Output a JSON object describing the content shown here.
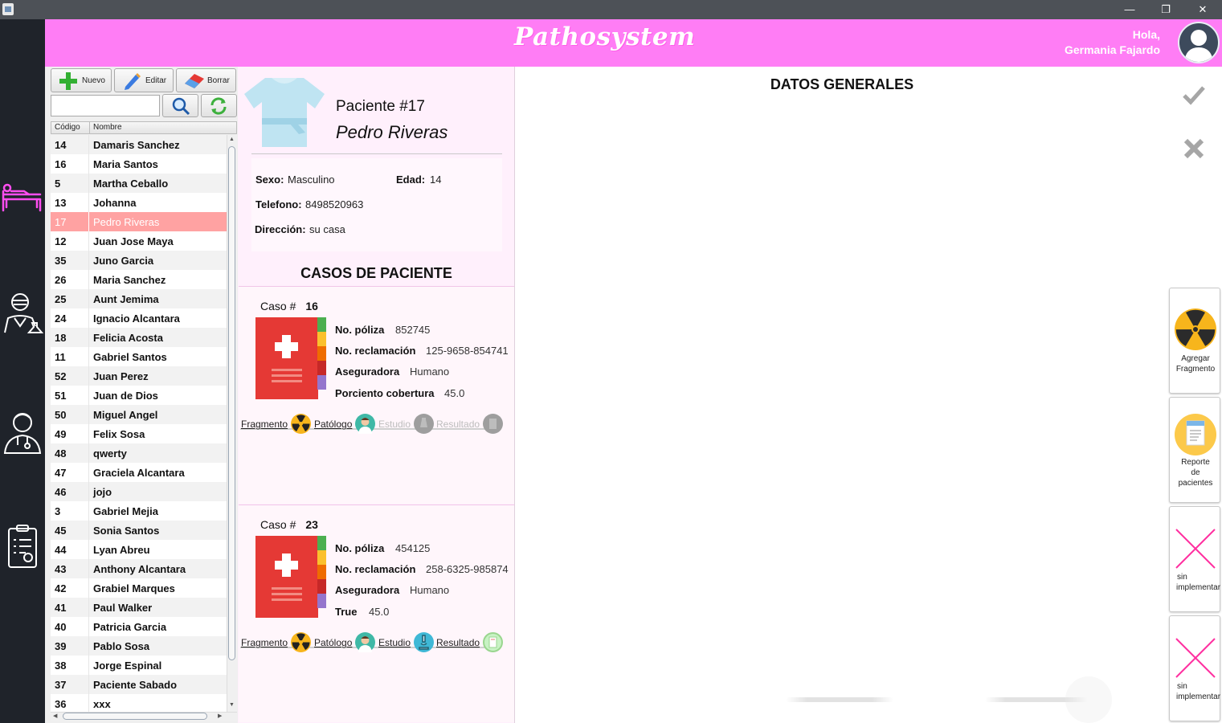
{
  "window": {
    "minimize": "—",
    "restore": "❐",
    "close": "✕"
  },
  "header": {
    "brand": "Pathosystem",
    "greeting": "Hola,",
    "user": "Germania Fajardo"
  },
  "toolbar": {
    "new_label": "Nuevo",
    "edit_label": "Editar",
    "delete_label": "Borrar"
  },
  "search": {
    "value": ""
  },
  "table": {
    "col_code": "Código",
    "col_name": "Nombre",
    "rows": [
      {
        "code": "14",
        "name": "Damaris Sanchez"
      },
      {
        "code": "16",
        "name": "Maria Santos"
      },
      {
        "code": "5",
        "name": "Martha Ceballo"
      },
      {
        "code": "13",
        "name": "Johanna"
      },
      {
        "code": "17",
        "name": "Pedro Riveras",
        "selected": true
      },
      {
        "code": "12",
        "name": "Juan Jose Maya"
      },
      {
        "code": "35",
        "name": "Juno Garcia"
      },
      {
        "code": "26",
        "name": "Maria Sanchez"
      },
      {
        "code": "25",
        "name": "Aunt Jemima"
      },
      {
        "code": "24",
        "name": "Ignacio Alcantara"
      },
      {
        "code": "18",
        "name": "Felicia Acosta"
      },
      {
        "code": "11",
        "name": "Gabriel Santos"
      },
      {
        "code": "52",
        "name": "Juan Perez"
      },
      {
        "code": "51",
        "name": "Juan de Dios"
      },
      {
        "code": "50",
        "name": "Miguel Angel"
      },
      {
        "code": "49",
        "name": "Felix Sosa"
      },
      {
        "code": "48",
        "name": "qwerty"
      },
      {
        "code": "47",
        "name": "Graciela Alcantara"
      },
      {
        "code": "46",
        "name": "jojo"
      },
      {
        "code": "3",
        "name": "Gabriel Mejia"
      },
      {
        "code": "45",
        "name": "Sonia Santos"
      },
      {
        "code": "44",
        "name": "Lyan Abreu"
      },
      {
        "code": "43",
        "name": "Anthony Alcantara"
      },
      {
        "code": "42",
        "name": "Grabiel Marques"
      },
      {
        "code": "41",
        "name": "Paul Walker"
      },
      {
        "code": "40",
        "name": "Patricia Garcia"
      },
      {
        "code": "39",
        "name": "Pablo Sosa"
      },
      {
        "code": "38",
        "name": "Jorge Espinal"
      },
      {
        "code": "37",
        "name": "Paciente Sabado"
      },
      {
        "code": "36",
        "name": "xxx"
      }
    ]
  },
  "patient": {
    "title": "Paciente #17",
    "name": "Pedro Riveras",
    "sexo_label": "Sexo:",
    "sexo": "Masculino",
    "edad_label": "Edad:",
    "edad": "14",
    "telefono_label": "Telefono:",
    "telefono": "8498520963",
    "direccion_label": "Dirección:",
    "direccion": "su casa"
  },
  "cases_title": "CASOS DE PACIENTE",
  "cases": [
    {
      "case_label": "Caso #",
      "case_number": "16",
      "poliza_label": "No. póliza",
      "poliza": "852745",
      "reclamacion_label": "No. reclamación",
      "reclamacion": "125-9658-854741",
      "aseguradora_label": "Aseguradora",
      "aseguradora": "Humano",
      "cobertura_label": "Porciento cobertura",
      "cobertura": "45.0",
      "steps": [
        "Fragmento",
        "Patólogo",
        "Estudio",
        "Resultado"
      ]
    },
    {
      "case_label": "Caso #",
      "case_number": "23",
      "poliza_label": "No. póliza",
      "poliza": "454125",
      "reclamacion_label": "No. reclamación",
      "reclamacion": "258-6325-985874",
      "aseguradora_label": "Aseguradora",
      "aseguradora": "Humano",
      "cobertura_label": "True",
      "cobertura": "45.0",
      "steps": [
        "Fragmento",
        "Patólogo",
        "Estudio",
        "Resultado"
      ]
    }
  ],
  "main": {
    "title": "DATOS GENERALES"
  },
  "side_buttons": {
    "agregar": [
      "Agregar",
      "Fragmento"
    ],
    "reporte": [
      "Reporte",
      "de",
      "pacientes"
    ],
    "sin1": [
      "sin",
      "implementar"
    ],
    "sin2": [
      "sin",
      "implementar"
    ]
  },
  "colors": {
    "header": "#ff7df5",
    "nav": "#1f232a",
    "selected_row": "#ffa2a2",
    "case_red": "#e53935",
    "radiation_yellow": "#f7b51c",
    "pink_x": "#ff2fa0"
  },
  "icons": {
    "nav": [
      "patient-bed-icon",
      "lab-technician-icon",
      "doctor-icon",
      "clipboard-report-icon"
    ],
    "actions": [
      "check-icon",
      "close-icon",
      "radiation-icon",
      "report-icon"
    ]
  }
}
